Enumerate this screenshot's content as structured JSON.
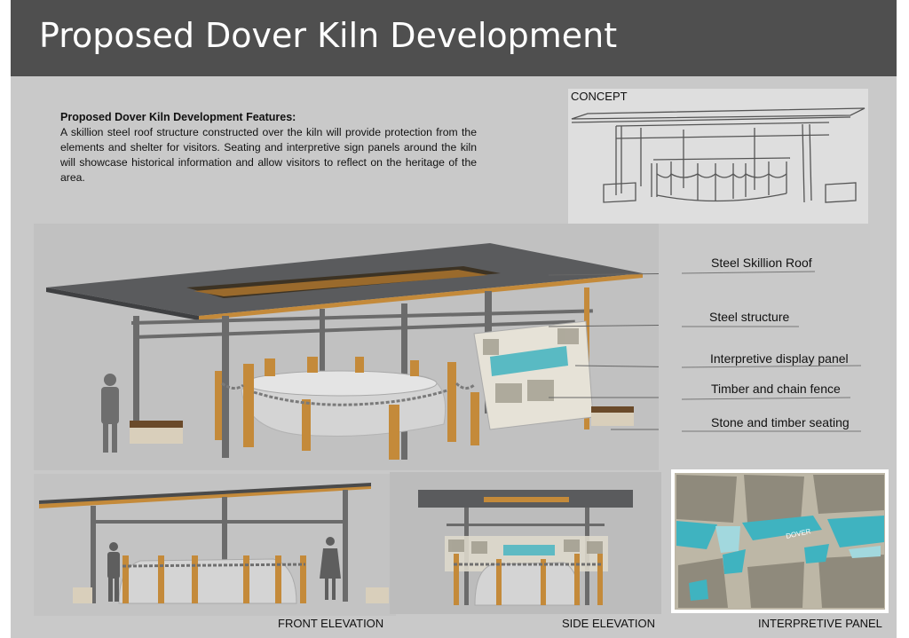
{
  "header": {
    "title": "Proposed Dover Kiln Development"
  },
  "intro": {
    "heading": "Proposed Dover Kiln Development Features:",
    "body": "A skillion steel roof structure constructed over the kiln will provide protection from the elements and shelter for visitors. Seating and interpretive sign panels around the kiln will showcase historical information and allow visitors to reflect on the heritage of the area."
  },
  "concept": {
    "label": "CONCEPT"
  },
  "callouts": [
    {
      "label": "Steel Skillion Roof"
    },
    {
      "label": "Steel structure"
    },
    {
      "label": "Interpretive display panel"
    },
    {
      "label": "Timber and chain fence"
    },
    {
      "label": "Stone and timber seating"
    }
  ],
  "captions": {
    "front": "FRONT ELEVATION",
    "side": "SIDE ELEVATION",
    "panel": "INTERPRETIVE PANEL"
  },
  "interpretive_panel": {
    "word": "DOVER"
  },
  "colors": {
    "header": "#4f4f4f",
    "background": "#c9c9c9",
    "roof": "#5a5b5d",
    "steel": "#6b6b6b",
    "timber": "#c48a3a",
    "kiln": "#d4d4d4",
    "panel_accent": "#3fb3c0"
  }
}
